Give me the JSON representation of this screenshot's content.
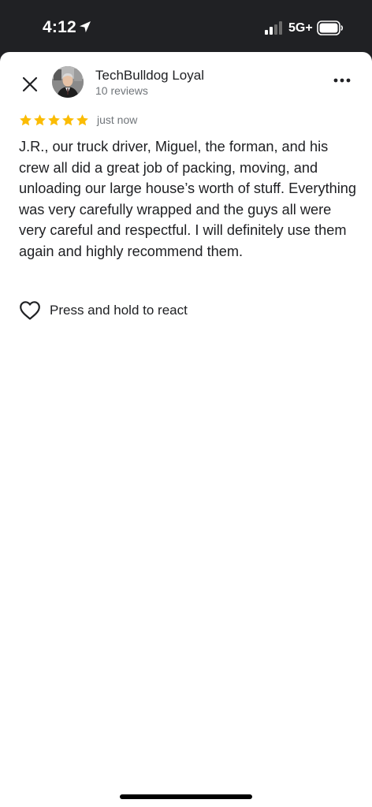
{
  "status_bar": {
    "time": "4:12",
    "network": "5G+",
    "location_icon": "location-arrow-icon",
    "signal_icon": "cellular-signal-icon",
    "battery_icon": "battery-icon"
  },
  "review": {
    "close_icon": "close-icon",
    "more_icon": "more-options-icon",
    "reviewer_name": "TechBulldog Loyal",
    "reviewer_reviews": "10 reviews",
    "rating_stars": 5,
    "time_ago": "just now",
    "text": "J.R., our truck driver, Miguel, the forman, and his crew all did a great job of packing, moving, and unloading our large house’s worth of stuff. Everything was very carefully wrapped and the guys all were very careful and respectful.  I will definitely use them again and highly recommend them.",
    "react_label": "Press and hold to react",
    "react_icon": "heart-outline-icon"
  },
  "colors": {
    "status_bar_bg": "#202124",
    "star": "#FBBC04",
    "primary_text": "#202124",
    "secondary_text": "#70757a"
  }
}
